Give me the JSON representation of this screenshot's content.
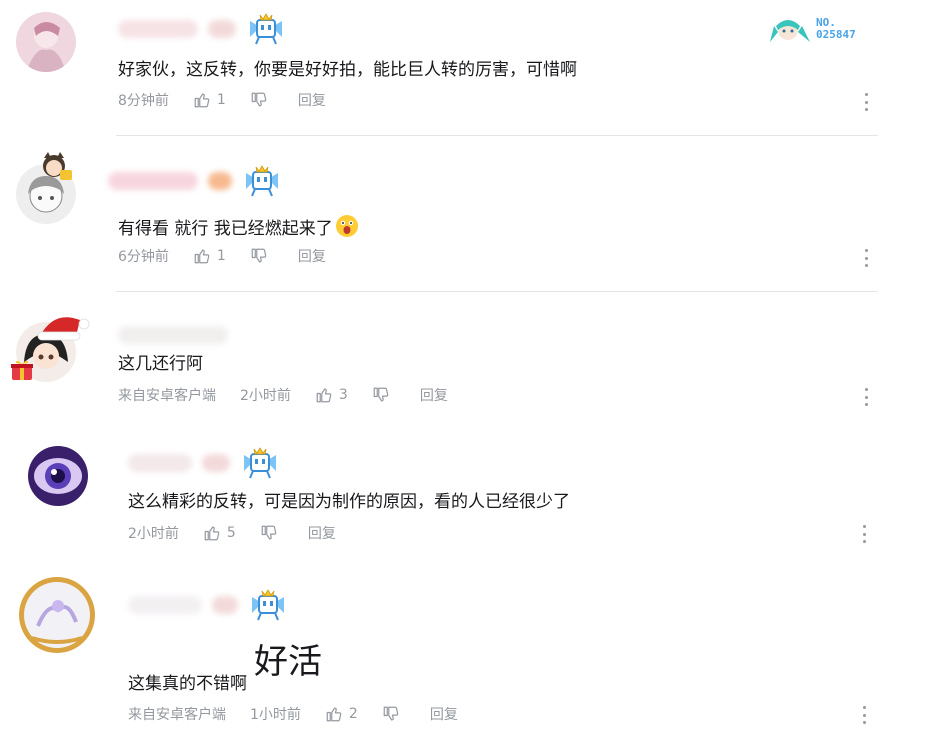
{
  "comments": [
    {
      "text": "好家伙，这反转，你要是好好拍，能比巨人转的厉害，可惜啊",
      "time": "8分钟前",
      "likes": "1",
      "reply": "回复",
      "fan_badge_no": "NO.\n025847"
    },
    {
      "text": "有得看 就行  我已经燃起来了",
      "time": "6分钟前",
      "likes": "1",
      "reply": "回复"
    },
    {
      "text": "这几还行阿",
      "source": "来自安卓客户端",
      "time": "2小时前",
      "likes": "3",
      "reply": "回复"
    },
    {
      "text": "这么精彩的反转，可是因为制作的原因，看的人已经很少了",
      "time": "2小时前",
      "likes": "5",
      "reply": "回复"
    },
    {
      "text": "这集真的不错啊",
      "overlay": "好活",
      "source": "来自安卓客户端",
      "time": "1小时前",
      "likes": "2",
      "reply": "回复"
    }
  ],
  "badge_no_line1": "NO.",
  "badge_no_line2": "025847",
  "colors": {
    "meta": "#9499a0",
    "divider": "#e3e5e7",
    "badge": "#4aa3e8"
  }
}
